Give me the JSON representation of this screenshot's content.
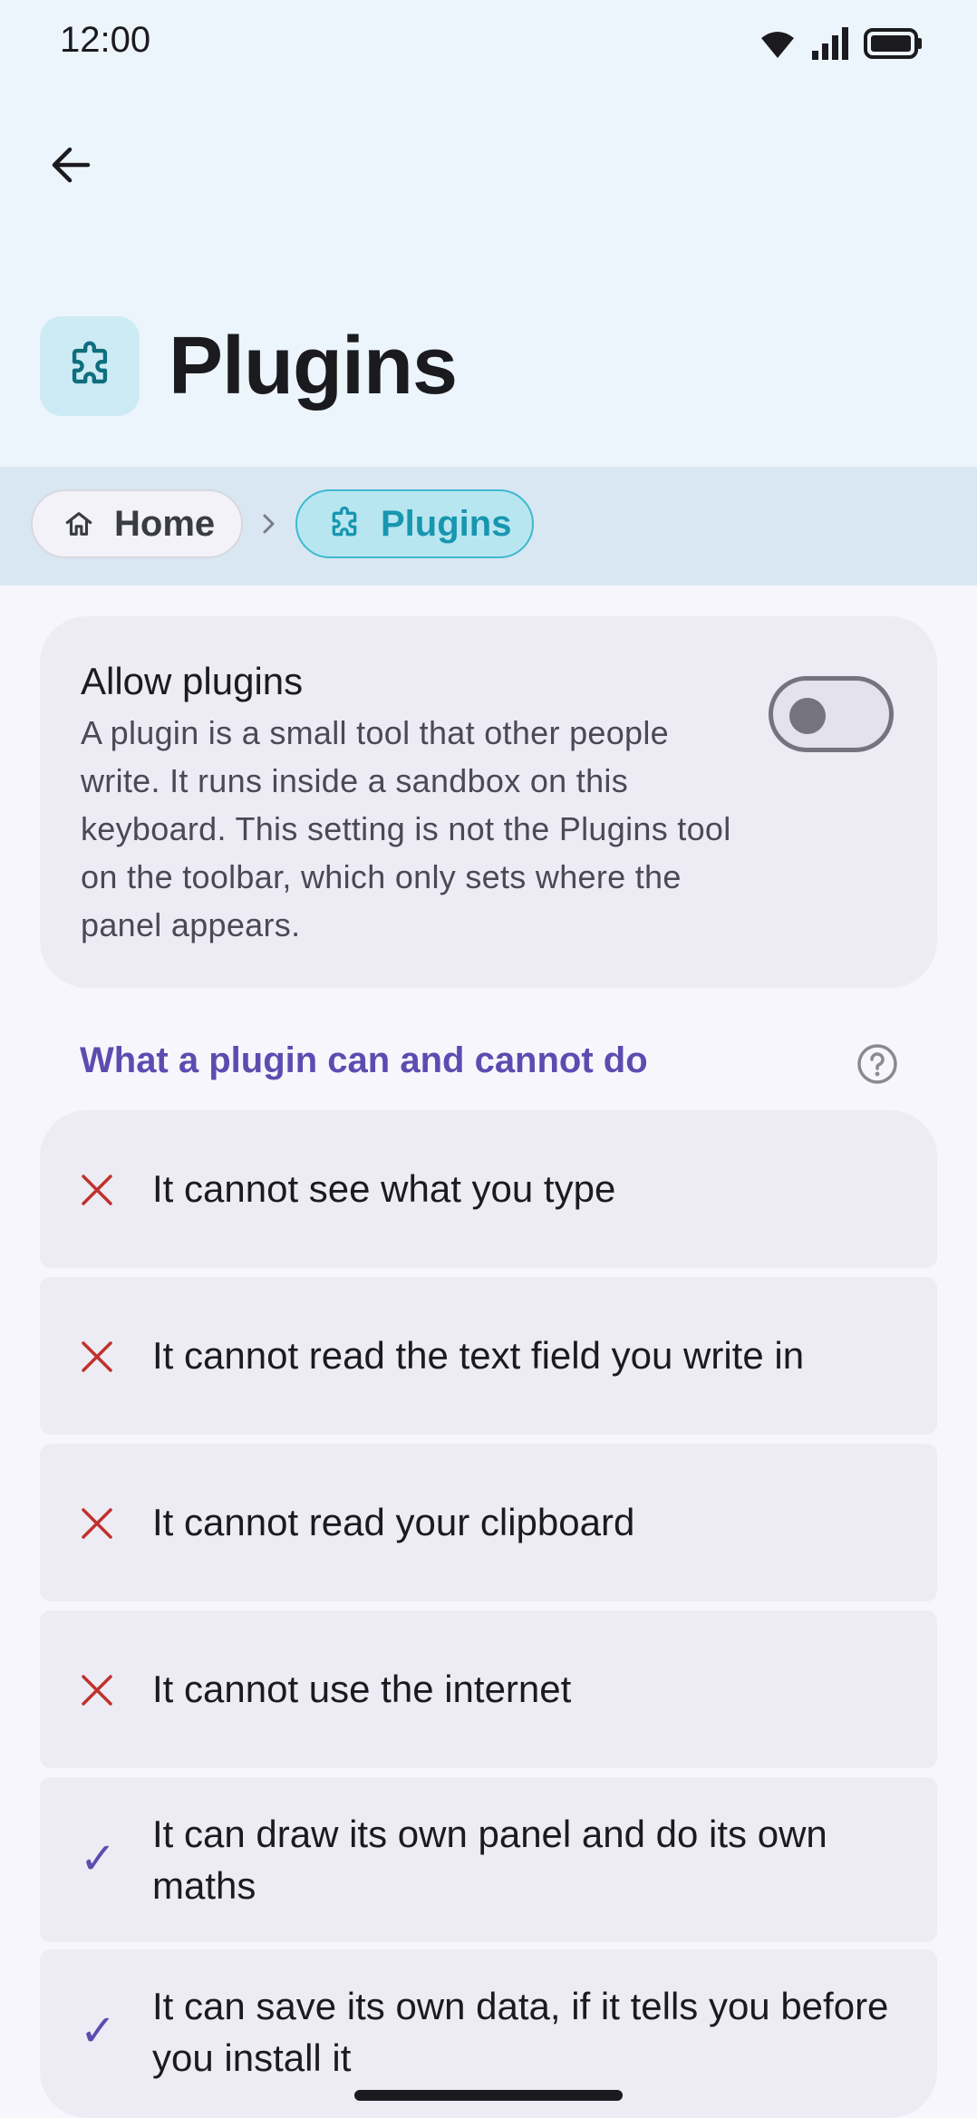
{
  "status_bar": {
    "time": "12:00"
  },
  "header": {
    "title": "Plugins"
  },
  "breadcrumb": {
    "items": [
      {
        "label": "Home",
        "icon": "home-icon"
      },
      {
        "label": "Plugins",
        "icon": "puzzle-icon"
      }
    ]
  },
  "allow_plugins": {
    "title": "Allow plugins",
    "description": "A plugin is a small tool that other people write. It runs inside a sandbox on this keyboard. This setting is not the Plugins tool on the toolbar, which only sets where the panel appears.",
    "enabled": false
  },
  "capabilities": {
    "title": "What a plugin can and cannot do",
    "items": [
      {
        "text": "It cannot see what you type",
        "allowed": false
      },
      {
        "text": "It cannot read the text field you write in",
        "allowed": false
      },
      {
        "text": "It cannot read your clipboard",
        "allowed": false
      },
      {
        "text": "It cannot use the internet",
        "allowed": false
      },
      {
        "text": "It can draw its own panel and do its own maths",
        "allowed": true
      },
      {
        "text": "It can save its own data, if it tells you before you install it",
        "allowed": true
      }
    ]
  },
  "colors": {
    "accent": "#5B4DB0",
    "deny": "#C0312B",
    "header_bg": "#EDF5FC",
    "breadcrumb_bg": "#D8E7F2",
    "active_chip": "#1896B0"
  }
}
